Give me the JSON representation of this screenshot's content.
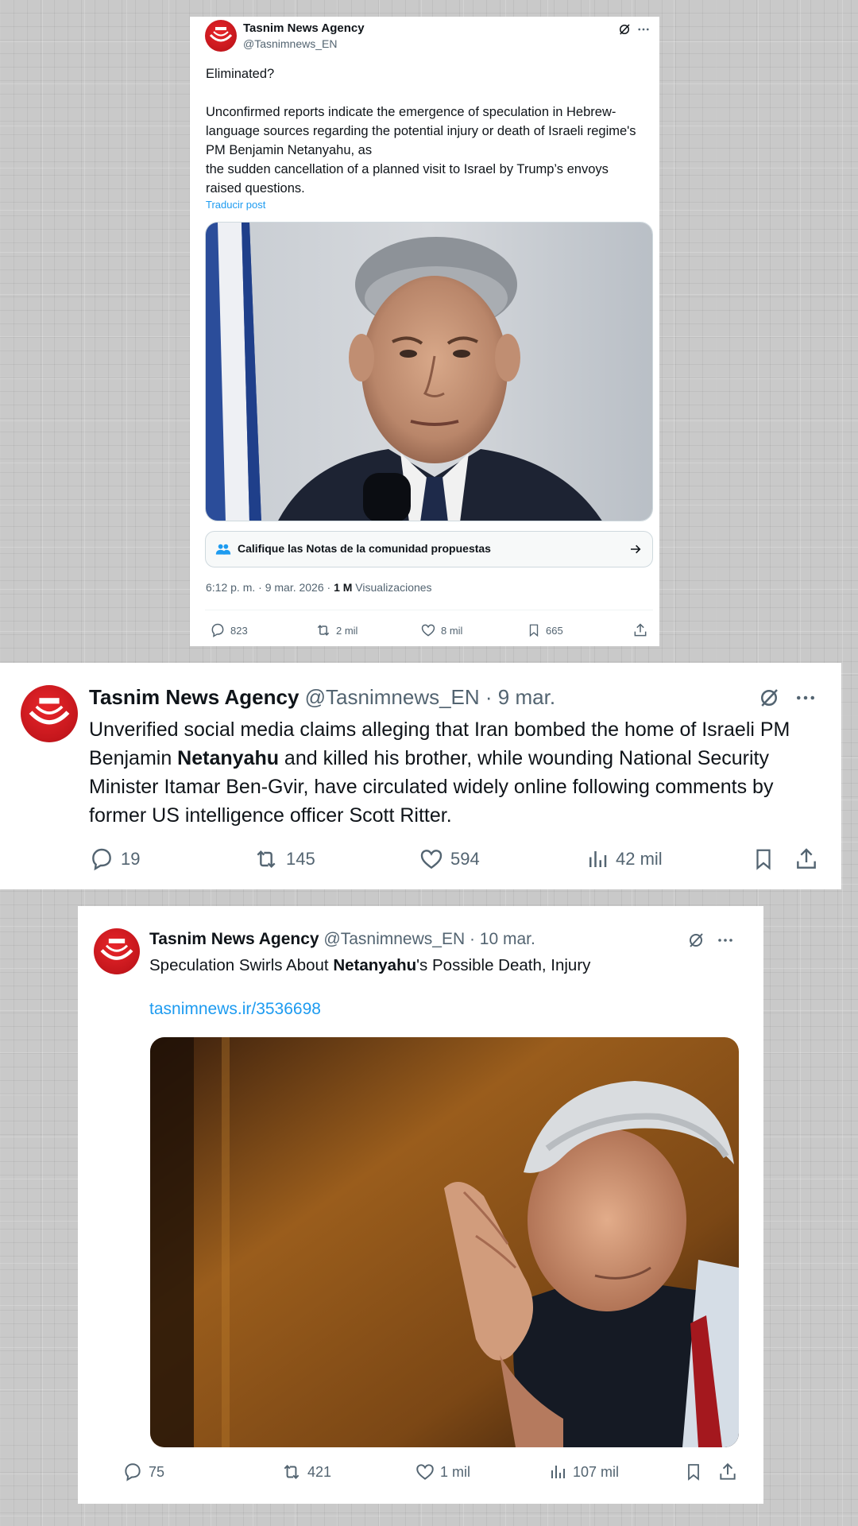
{
  "tweet1": {
    "name": "Tasnim News Agency",
    "handle": "@Tasnimnews_EN",
    "body_lines": [
      "Eliminated?",
      "",
      "Unconfirmed reports indicate the emergence of speculation in Hebrew-language sources regarding the potential injury or death of Israeli regime's PM Benjamin Netanyahu, as",
      "the sudden cancellation of a planned visit to Israel by Trump’s envoys raised questions."
    ],
    "line1": "Eliminated?",
    "line2": "Unconfirmed reports indicate the emergence of speculation in Hebrew-language sources regarding the potential injury or death of Israeli regime's PM Benjamin Netanyahu, as",
    "line3": "the sudden cancellation of a planned visit to Israel by Trump’s envoys raised questions.",
    "translate": "Traducir post",
    "community_notes": "Califique las Notas de la comunidad propuestas",
    "time": "6:12 p. m. · 9 mar. 2026 · ",
    "views_count": "1 M",
    "views_label": " Visualizaciones",
    "replies": "823",
    "reposts": "2 mil",
    "likes": "8 mil",
    "bookmarks": "665"
  },
  "tweet2": {
    "name": "Tasnim News Agency",
    "handle": "@Tasnimnews_EN",
    "date": " · 9 mar.",
    "body_pre": "Unverified social media claims alleging that Iran bombed the home of Israeli PM Benjamin ",
    "body_bold": "Netanyahu",
    "body_post": " and killed his brother, while wounding National Security Minister Itamar Ben-Gvir, have circulated widely online following comments by former US intelligence officer Scott Ritter.",
    "replies": "19",
    "reposts": "145",
    "likes": "594",
    "views": "42 mil"
  },
  "tweet3": {
    "name": "Tasnim News Agency",
    "handle": "@Tasnimnews_EN",
    "date": " · 10 mar.",
    "body_pre": "Speculation Swirls About ",
    "body_bold": "Netanyahu",
    "body_post": "'s Possible Death, Injury",
    "link": "tasnimnews.ir/3536698",
    "replies": "75",
    "reposts": "421",
    "likes": "1 mil",
    "views": "107 mil"
  },
  "colors": {
    "brand_red": "#c4161c",
    "link_blue": "#1d9bf0",
    "muted_gray": "#536471",
    "community_notes_blue": "#1d9bf0"
  },
  "icons": [
    "grok-icon",
    "more-icon",
    "reply-icon",
    "repost-icon",
    "like-icon",
    "views-icon",
    "bookmark-icon",
    "share-icon",
    "community-notes-icon",
    "arrow-right-icon"
  ]
}
